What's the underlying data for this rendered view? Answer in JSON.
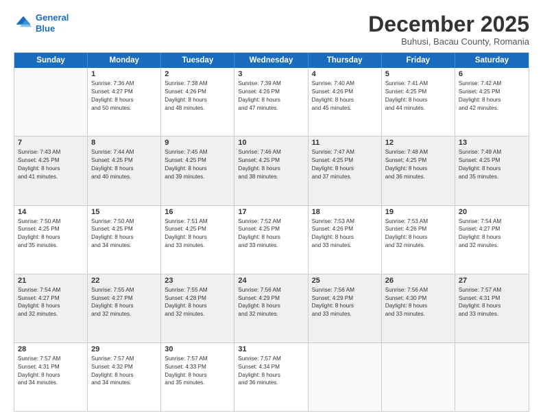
{
  "logo": {
    "line1": "General",
    "line2": "Blue"
  },
  "header": {
    "title": "December 2025",
    "location": "Buhusi, Bacau County, Romania"
  },
  "weekdays": [
    "Sunday",
    "Monday",
    "Tuesday",
    "Wednesday",
    "Thursday",
    "Friday",
    "Saturday"
  ],
  "weeks": [
    [
      {
        "day": "",
        "sunrise": "",
        "sunset": "",
        "daylight": "",
        "shaded": false,
        "empty": true
      },
      {
        "day": "1",
        "sunrise": "Sunrise: 7:36 AM",
        "sunset": "Sunset: 4:27 PM",
        "daylight": "Daylight: 8 hours",
        "daylight2": "and 50 minutes.",
        "shaded": false
      },
      {
        "day": "2",
        "sunrise": "Sunrise: 7:38 AM",
        "sunset": "Sunset: 4:26 PM",
        "daylight": "Daylight: 8 hours",
        "daylight2": "and 48 minutes.",
        "shaded": false
      },
      {
        "day": "3",
        "sunrise": "Sunrise: 7:39 AM",
        "sunset": "Sunset: 4:26 PM",
        "daylight": "Daylight: 8 hours",
        "daylight2": "and 47 minutes.",
        "shaded": false
      },
      {
        "day": "4",
        "sunrise": "Sunrise: 7:40 AM",
        "sunset": "Sunset: 4:26 PM",
        "daylight": "Daylight: 8 hours",
        "daylight2": "and 45 minutes.",
        "shaded": false
      },
      {
        "day": "5",
        "sunrise": "Sunrise: 7:41 AM",
        "sunset": "Sunset: 4:25 PM",
        "daylight": "Daylight: 8 hours",
        "daylight2": "and 44 minutes.",
        "shaded": false
      },
      {
        "day": "6",
        "sunrise": "Sunrise: 7:42 AM",
        "sunset": "Sunset: 4:25 PM",
        "daylight": "Daylight: 8 hours",
        "daylight2": "and 42 minutes.",
        "shaded": false
      }
    ],
    [
      {
        "day": "7",
        "sunrise": "Sunrise: 7:43 AM",
        "sunset": "Sunset: 4:25 PM",
        "daylight": "Daylight: 8 hours",
        "daylight2": "and 41 minutes.",
        "shaded": true
      },
      {
        "day": "8",
        "sunrise": "Sunrise: 7:44 AM",
        "sunset": "Sunset: 4:25 PM",
        "daylight": "Daylight: 8 hours",
        "daylight2": "and 40 minutes.",
        "shaded": true
      },
      {
        "day": "9",
        "sunrise": "Sunrise: 7:45 AM",
        "sunset": "Sunset: 4:25 PM",
        "daylight": "Daylight: 8 hours",
        "daylight2": "and 39 minutes.",
        "shaded": true
      },
      {
        "day": "10",
        "sunrise": "Sunrise: 7:46 AM",
        "sunset": "Sunset: 4:25 PM",
        "daylight": "Daylight: 8 hours",
        "daylight2": "and 38 minutes.",
        "shaded": true
      },
      {
        "day": "11",
        "sunrise": "Sunrise: 7:47 AM",
        "sunset": "Sunset: 4:25 PM",
        "daylight": "Daylight: 8 hours",
        "daylight2": "and 37 minutes.",
        "shaded": true
      },
      {
        "day": "12",
        "sunrise": "Sunrise: 7:48 AM",
        "sunset": "Sunset: 4:25 PM",
        "daylight": "Daylight: 8 hours",
        "daylight2": "and 36 minutes.",
        "shaded": true
      },
      {
        "day": "13",
        "sunrise": "Sunrise: 7:49 AM",
        "sunset": "Sunset: 4:25 PM",
        "daylight": "Daylight: 8 hours",
        "daylight2": "and 35 minutes.",
        "shaded": true
      }
    ],
    [
      {
        "day": "14",
        "sunrise": "Sunrise: 7:50 AM",
        "sunset": "Sunset: 4:25 PM",
        "daylight": "Daylight: 8 hours",
        "daylight2": "and 35 minutes.",
        "shaded": false
      },
      {
        "day": "15",
        "sunrise": "Sunrise: 7:50 AM",
        "sunset": "Sunset: 4:25 PM",
        "daylight": "Daylight: 8 hours",
        "daylight2": "and 34 minutes.",
        "shaded": false
      },
      {
        "day": "16",
        "sunrise": "Sunrise: 7:51 AM",
        "sunset": "Sunset: 4:25 PM",
        "daylight": "Daylight: 8 hours",
        "daylight2": "and 33 minutes.",
        "shaded": false
      },
      {
        "day": "17",
        "sunrise": "Sunrise: 7:52 AM",
        "sunset": "Sunset: 4:25 PM",
        "daylight": "Daylight: 8 hours",
        "daylight2": "and 33 minutes.",
        "shaded": false
      },
      {
        "day": "18",
        "sunrise": "Sunrise: 7:53 AM",
        "sunset": "Sunset: 4:26 PM",
        "daylight": "Daylight: 8 hours",
        "daylight2": "and 33 minutes.",
        "shaded": false
      },
      {
        "day": "19",
        "sunrise": "Sunrise: 7:53 AM",
        "sunset": "Sunset: 4:26 PM",
        "daylight": "Daylight: 8 hours",
        "daylight2": "and 32 minutes.",
        "shaded": false
      },
      {
        "day": "20",
        "sunrise": "Sunrise: 7:54 AM",
        "sunset": "Sunset: 4:27 PM",
        "daylight": "Daylight: 8 hours",
        "daylight2": "and 32 minutes.",
        "shaded": false
      }
    ],
    [
      {
        "day": "21",
        "sunrise": "Sunrise: 7:54 AM",
        "sunset": "Sunset: 4:27 PM",
        "daylight": "Daylight: 8 hours",
        "daylight2": "and 32 minutes.",
        "shaded": true
      },
      {
        "day": "22",
        "sunrise": "Sunrise: 7:55 AM",
        "sunset": "Sunset: 4:27 PM",
        "daylight": "Daylight: 8 hours",
        "daylight2": "and 32 minutes.",
        "shaded": true
      },
      {
        "day": "23",
        "sunrise": "Sunrise: 7:55 AM",
        "sunset": "Sunset: 4:28 PM",
        "daylight": "Daylight: 8 hours",
        "daylight2": "and 32 minutes.",
        "shaded": true
      },
      {
        "day": "24",
        "sunrise": "Sunrise: 7:56 AM",
        "sunset": "Sunset: 4:29 PM",
        "daylight": "Daylight: 8 hours",
        "daylight2": "and 32 minutes.",
        "shaded": true
      },
      {
        "day": "25",
        "sunrise": "Sunrise: 7:56 AM",
        "sunset": "Sunset: 4:29 PM",
        "daylight": "Daylight: 8 hours",
        "daylight2": "and 33 minutes.",
        "shaded": true
      },
      {
        "day": "26",
        "sunrise": "Sunrise: 7:56 AM",
        "sunset": "Sunset: 4:30 PM",
        "daylight": "Daylight: 8 hours",
        "daylight2": "and 33 minutes.",
        "shaded": true
      },
      {
        "day": "27",
        "sunrise": "Sunrise: 7:57 AM",
        "sunset": "Sunset: 4:31 PM",
        "daylight": "Daylight: 8 hours",
        "daylight2": "and 33 minutes.",
        "shaded": true
      }
    ],
    [
      {
        "day": "28",
        "sunrise": "Sunrise: 7:57 AM",
        "sunset": "Sunset: 4:31 PM",
        "daylight": "Daylight: 8 hours",
        "daylight2": "and 34 minutes.",
        "shaded": false
      },
      {
        "day": "29",
        "sunrise": "Sunrise: 7:57 AM",
        "sunset": "Sunset: 4:32 PM",
        "daylight": "Daylight: 8 hours",
        "daylight2": "and 34 minutes.",
        "shaded": false
      },
      {
        "day": "30",
        "sunrise": "Sunrise: 7:57 AM",
        "sunset": "Sunset: 4:33 PM",
        "daylight": "Daylight: 8 hours",
        "daylight2": "and 35 minutes.",
        "shaded": false
      },
      {
        "day": "31",
        "sunrise": "Sunrise: 7:57 AM",
        "sunset": "Sunset: 4:34 PM",
        "daylight": "Daylight: 8 hours",
        "daylight2": "and 36 minutes.",
        "shaded": false
      },
      {
        "day": "",
        "sunrise": "",
        "sunset": "",
        "daylight": "",
        "daylight2": "",
        "shaded": false,
        "empty": true
      },
      {
        "day": "",
        "sunrise": "",
        "sunset": "",
        "daylight": "",
        "daylight2": "",
        "shaded": false,
        "empty": true
      },
      {
        "day": "",
        "sunrise": "",
        "sunset": "",
        "daylight": "",
        "daylight2": "",
        "shaded": false,
        "empty": true
      }
    ]
  ]
}
